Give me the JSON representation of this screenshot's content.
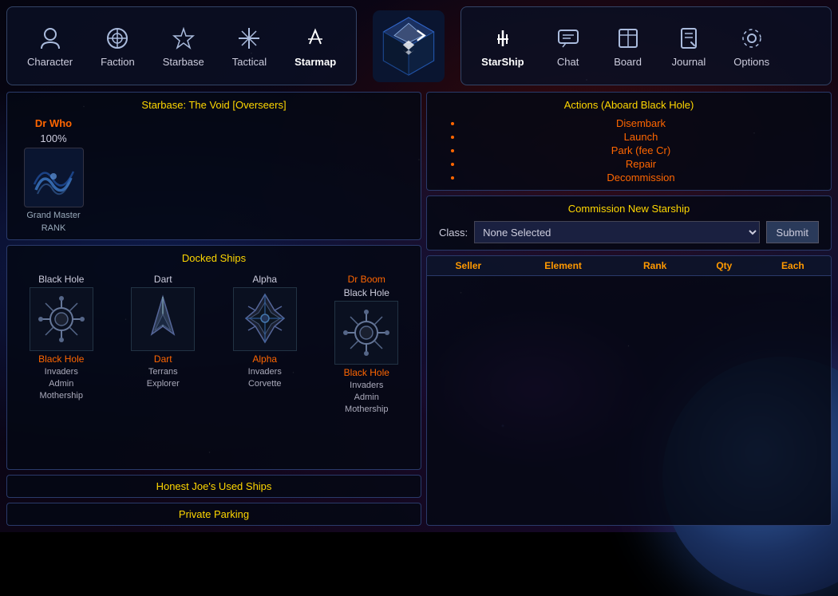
{
  "nav": {
    "left_items": [
      {
        "id": "character",
        "label": "Character",
        "icon": "👤"
      },
      {
        "id": "faction",
        "label": "Faction",
        "icon": "✦"
      },
      {
        "id": "starbase",
        "label": "Starbase",
        "icon": "🔷"
      },
      {
        "id": "tactical",
        "label": "Tactical",
        "icon": "✥"
      },
      {
        "id": "starmap",
        "label": "Starmap",
        "icon": "✦",
        "active": true
      }
    ],
    "right_items": [
      {
        "id": "starship",
        "label": "StarShip",
        "icon": "🚀",
        "active": true
      },
      {
        "id": "chat",
        "label": "Chat",
        "icon": "💬"
      },
      {
        "id": "board",
        "label": "Board",
        "icon": "📋"
      },
      {
        "id": "journal",
        "label": "Journal",
        "icon": "✏️"
      },
      {
        "id": "options",
        "label": "Options",
        "icon": "⚙️"
      }
    ]
  },
  "left_panel": {
    "starbase_title": "Starbase: The Void [Overseers]",
    "character": {
      "name": "Dr Who",
      "percent": "100%",
      "rank_title": "Grand Master",
      "rank_label": "RANK"
    },
    "docked_ships": {
      "title": "Docked Ships",
      "ships": [
        {
          "name_top": "Black Hole",
          "name_link": "Black Hole",
          "faction": "Invaders",
          "type1": "Admin",
          "type2": "Mothership"
        },
        {
          "name_top": "Dart",
          "name_link": "Dart",
          "faction": "Terrans",
          "type1": "Explorer",
          "type2": ""
        },
        {
          "name_top": "Alpha",
          "name_link": "Alpha",
          "faction": "Invaders",
          "type1": "Corvette",
          "type2": ""
        },
        {
          "name_top": "Dr Boom",
          "name_sub": "Black Hole",
          "name_link": "Black Hole",
          "faction": "Invaders",
          "type1": "Admin",
          "type2": "Mothership"
        }
      ]
    },
    "used_ships_title": "Honest Joe's Used Ships",
    "private_parking_title": "Private Parking"
  },
  "right_panel": {
    "actions": {
      "title": "Actions (Aboard Black Hole)",
      "items": [
        "Disembark",
        "Launch",
        "Park (fee Cr)",
        "Repair",
        "Decommission"
      ]
    },
    "commission": {
      "title": "Commission New Starship",
      "class_label": "Class:",
      "class_default": "None Selected",
      "submit_label": "Submit",
      "class_options": [
        "None Selected"
      ]
    },
    "market": {
      "columns": [
        "Seller",
        "Element",
        "Rank",
        "Qty",
        "Each"
      ],
      "rows": []
    }
  }
}
